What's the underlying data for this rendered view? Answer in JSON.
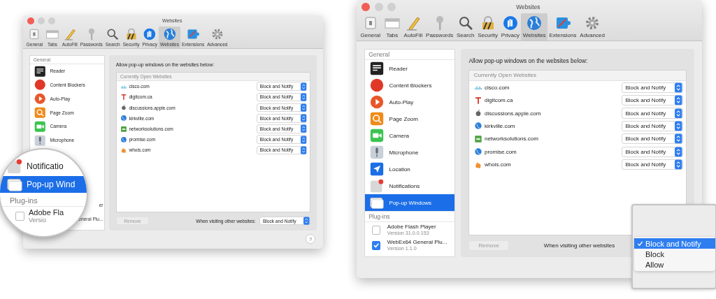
{
  "windows": [
    {
      "title": "Websites",
      "toolbar": [
        {
          "label": "General",
          "selected": false
        },
        {
          "label": "Tabs",
          "selected": false
        },
        {
          "label": "AutoFill",
          "selected": false
        },
        {
          "label": "Passwords",
          "selected": false
        },
        {
          "label": "Search",
          "selected": false
        },
        {
          "label": "Security",
          "selected": false
        },
        {
          "label": "Privacy",
          "selected": false
        },
        {
          "label": "Websites",
          "selected": true
        },
        {
          "label": "Extensions",
          "selected": false
        },
        {
          "label": "Advanced",
          "selected": false
        }
      ],
      "sidebar": {
        "header": "General",
        "items": [
          {
            "label": "Reader",
            "selected": false
          },
          {
            "label": "Content Blockers",
            "selected": false
          },
          {
            "label": "Auto-Play",
            "selected": false
          },
          {
            "label": "Page Zoom",
            "selected": false
          },
          {
            "label": "Camera",
            "selected": false
          },
          {
            "label": "Microphone",
            "selected": false
          }
        ],
        "fragments": [
          "er",
          "eneral Plu..."
        ]
      },
      "panel": {
        "heading": "Allow pop-up windows on the websites below:",
        "table_header": "Currently Open Websites",
        "rows": [
          {
            "site": "cisco.com",
            "setting": "Block and Notify"
          },
          {
            "site": "digitcom.ca",
            "setting": "Block and Notify"
          },
          {
            "site": "discussions.apple.com",
            "setting": "Block and Notify"
          },
          {
            "site": "kirkville.com",
            "setting": "Block and Notify"
          },
          {
            "site": "networksolutions.com",
            "setting": "Block and Notify"
          },
          {
            "site": "promise.com",
            "setting": "Block and Notify"
          },
          {
            "site": "whois.com",
            "setting": "Block and Notify"
          }
        ],
        "remove": {
          "label": "Remove",
          "disabled": true
        },
        "default_label": "When visiting other websites:",
        "default_setting": "Block and Notify"
      },
      "help": "?",
      "magnifier": {
        "kind": "sidebar",
        "items": [
          {
            "label": "Notificatio",
            "selected": false
          },
          {
            "label": "Pop-up Wind",
            "selected": true
          }
        ],
        "header": "Plug-ins",
        "plugins": [
          {
            "name": "Adobe Fla",
            "version": "Versio",
            "checked": false
          }
        ]
      }
    },
    {
      "title": "Websites",
      "toolbar": [
        {
          "label": "General",
          "selected": false
        },
        {
          "label": "Tabs",
          "selected": false
        },
        {
          "label": "AutoFill",
          "selected": false
        },
        {
          "label": "Passwords",
          "selected": false
        },
        {
          "label": "Search",
          "selected": false
        },
        {
          "label": "Security",
          "selected": false
        },
        {
          "label": "Privacy",
          "selected": false
        },
        {
          "label": "Websites",
          "selected": true
        },
        {
          "label": "Extensions",
          "selected": false
        },
        {
          "label": "Advanced",
          "selected": false
        }
      ],
      "sidebar": {
        "header": "General",
        "items": [
          {
            "label": "Reader",
            "selected": false
          },
          {
            "label": "Content Blockers",
            "selected": false
          },
          {
            "label": "Auto-Play",
            "selected": false
          },
          {
            "label": "Page Zoom",
            "selected": false
          },
          {
            "label": "Camera",
            "selected": false
          },
          {
            "label": "Microphone",
            "selected": false
          },
          {
            "label": "Location",
            "selected": false
          },
          {
            "label": "Notifications",
            "selected": false
          },
          {
            "label": "Pop-up Windows",
            "selected": true
          }
        ],
        "plugins_header": "Plug-ins",
        "plugins": [
          {
            "name": "Adobe Flash Player",
            "version": "Version 31.0.0.153",
            "checked": false
          },
          {
            "name": "WebEx64 General Plu...",
            "version": "Version 1.1.0",
            "checked": true
          }
        ]
      },
      "panel": {
        "heading": "Allow pop-up windows on the websites below:",
        "table_header": "Currently Open Websites",
        "rows": [
          {
            "site": "cisco.com",
            "setting": "Block and Notify"
          },
          {
            "site": "digitcom.ca",
            "setting": "Block and Notify"
          },
          {
            "site": "discussions.apple.com",
            "setting": "Block and Notify"
          },
          {
            "site": "kirkville.com",
            "setting": "Block and Notify"
          },
          {
            "site": "networksolutions.com",
            "setting": "Block and Notify"
          },
          {
            "site": "promise.com",
            "setting": "Block and Notify"
          },
          {
            "site": "whois.com",
            "setting": "Block and Notify"
          }
        ],
        "remove": {
          "label": "Remove",
          "disabled": true
        },
        "default_label": "When visiting other websites"
      },
      "magnifier": {
        "kind": "menu",
        "options": [
          {
            "label": "Block and Notify",
            "selected": true
          },
          {
            "label": "Block",
            "selected": false
          },
          {
            "label": "Allow",
            "selected": false
          }
        ]
      }
    }
  ]
}
